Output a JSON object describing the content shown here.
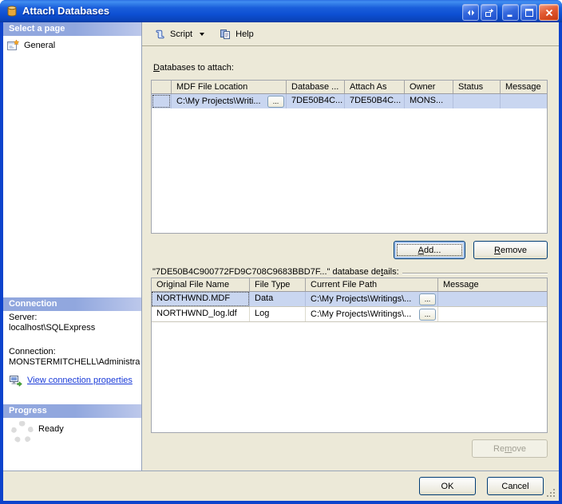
{
  "window": {
    "title": "Attach Databases"
  },
  "icons": {
    "titlebar": "database-cylinder",
    "general_page": "property-page-star",
    "connection_link": "computer-monitor-green-arrow",
    "progress": "spinner-ring",
    "script": "script-scroll",
    "script_dropdown": "chevron-down",
    "help": "document-pages",
    "window_controls": [
      "nav-arrows",
      "pop-out",
      "minimize",
      "maximize",
      "close"
    ],
    "resize_grip": "diagonal-dots"
  },
  "colors": {
    "titlebar_blue": "#1a5edb",
    "window_border": "#0d43cc",
    "panel_beige": "#ece9d8",
    "pane_header_blue": "#91a7de",
    "row_highlight": "#c9d6f0",
    "link_blue": "#1a3bd8",
    "close_button_red": "#d9532b"
  },
  "sidebar": {
    "select_page_header": "Select a page",
    "pages": [
      {
        "label": "General"
      }
    ],
    "connection_header": "Connection",
    "server_label": "Server:",
    "server_value": "localhost\\SQLExpress",
    "connection_label": "Connection:",
    "connection_value": "MONSTERMITCHELL\\Administra",
    "view_connection_link": "View connection properties",
    "progress_header": "Progress",
    "progress_status": "Ready"
  },
  "toolbar": {
    "script_label": "Script",
    "help_label": "Help"
  },
  "main": {
    "attach_label_key": "D",
    "attach_label_rest": "atabases to attach:",
    "attach_table": {
      "columns": [
        "",
        "MDF File Location",
        "Database ...",
        "Attach As",
        "Owner",
        "Status",
        "Message"
      ],
      "rows": [
        {
          "mdf": "C:\\My Projects\\Writi...",
          "browse": "...",
          "database": "7DE50B4C...",
          "attach_as": "7DE50B4C...",
          "owner": "MONS...",
          "status": "",
          "message": ""
        }
      ]
    },
    "add_key": "A",
    "add_rest": "dd...",
    "remove_key": "R",
    "remove_rest": "emove",
    "details_pre": "\"7DE50B4C900772FD9C708C9683BBD7F...\" database de",
    "details_key": "t",
    "details_post": "ails:",
    "details_table": {
      "columns": [
        "Original File Name",
        "File Type",
        "Current File Path",
        "Message"
      ],
      "rows": [
        {
          "name": "NORTHWND.MDF",
          "type": "Data",
          "path": "C:\\My Projects\\Writings\\...",
          "browse": "...",
          "message": ""
        },
        {
          "name": "NORTHWND_log.ldf",
          "type": "Log",
          "path": "C:\\My Projects\\Writings\\...",
          "browse": "...",
          "message": ""
        }
      ]
    },
    "remove2_pre": "Re",
    "remove2_key": "m",
    "remove2_post": "ove"
  },
  "footer": {
    "ok_label": "OK",
    "cancel_label": "Cancel"
  }
}
